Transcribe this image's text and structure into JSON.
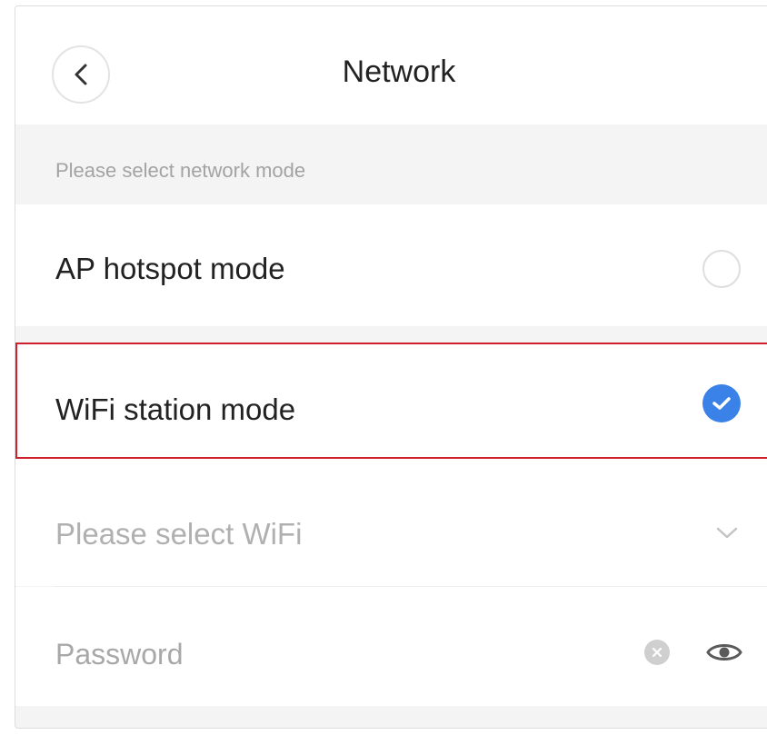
{
  "header": {
    "title": "Network",
    "back_icon": "chevron-left-icon"
  },
  "section": {
    "label": "Please select network mode"
  },
  "modes": [
    {
      "label": "AP hotspot mode",
      "selected": false
    },
    {
      "label": "WiFi station mode",
      "selected": true
    }
  ],
  "wifi_select": {
    "placeholder": "Please select WiFi",
    "icon": "chevron-down-icon"
  },
  "password": {
    "placeholder": "Password",
    "clear_icon": "clear-icon",
    "visibility_icon": "eye-icon"
  },
  "colors": {
    "accent": "#3b82e8",
    "highlight_border": "#d0202e"
  }
}
